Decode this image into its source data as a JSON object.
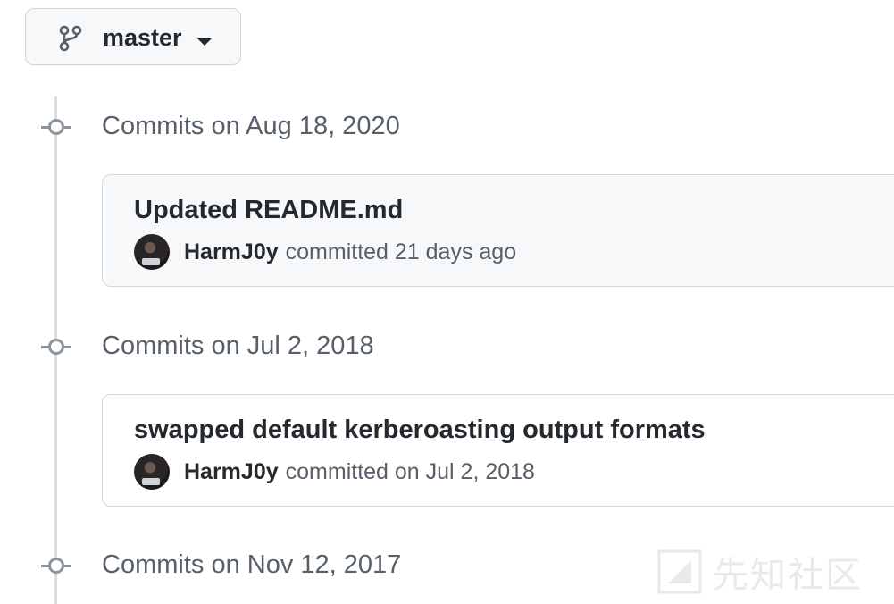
{
  "branch": {
    "name": "master",
    "icon": "git-branch-icon",
    "dropdown_icon": "triangle-down-icon"
  },
  "timeline": [
    {
      "heading": "Commits on Aug 18, 2020",
      "commits": [
        {
          "title": "Updated README.md",
          "author": "HarmJ0y",
          "when": "committed 21 days ago"
        }
      ]
    },
    {
      "heading": "Commits on Jul 2, 2018",
      "commits": [
        {
          "title": "swapped default kerberoasting output formats",
          "author": "HarmJ0y",
          "when": "committed on Jul 2, 2018"
        }
      ]
    },
    {
      "heading": "Commits on Nov 12, 2017",
      "commits": []
    }
  ],
  "watermark": {
    "text": "先知社区"
  },
  "colors": {
    "border": "#d0d7de",
    "muted_text": "#57606a",
    "primary_text": "#24292f",
    "timeline": "#d8dee4"
  }
}
